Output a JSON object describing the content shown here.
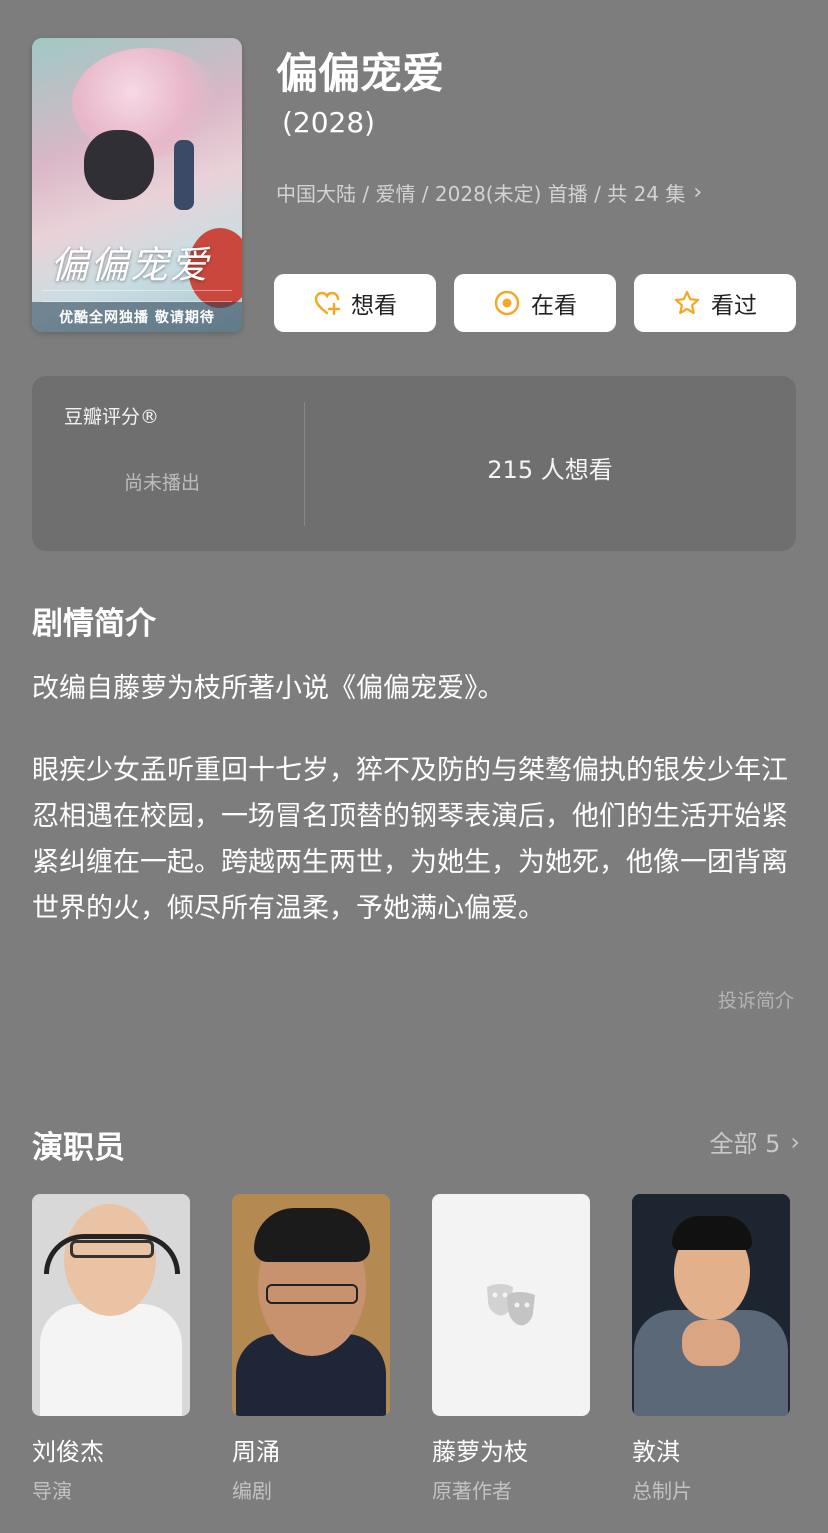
{
  "poster": {
    "title_art": "偏偏宠爱",
    "banner": "优酷全网独播 敬请期待"
  },
  "header": {
    "title": "偏偏宠爱",
    "year": "(2028)",
    "meta": "中国大陆 / 爱情 / 2028(未定) 首播 / 共 24 集"
  },
  "actions": [
    {
      "label": "想看",
      "icon": "heart-plus-icon",
      "color": "#f5a623"
    },
    {
      "label": "在看",
      "icon": "target-circle-icon",
      "color": "#f5a623"
    },
    {
      "label": "看过",
      "icon": "star-icon",
      "color": "#f5a623"
    }
  ],
  "rating": {
    "label": "豆瓣评分®",
    "status": "尚未播出",
    "wish_count": "215 人想看"
  },
  "synopsis": {
    "title": "剧情简介",
    "para1": "改编自藤萝为枝所著小说《偏偏宠爱》。",
    "para2": "眼疾少女孟听重回十七岁，猝不及防的与桀骜偏执的银发少年江忍相遇在校园，一场冒名顶替的钢琴表演后，他们的生活开始紧紧纠缠在一起。跨越两生两世，为她生，为她死，他像一团背离世界的火，倾尽所有温柔，予她满心偏爱。",
    "report": "投诉简介"
  },
  "cast": {
    "title": "演职员",
    "all_label": "全部 5",
    "members": [
      {
        "name": "刘俊杰",
        "role": "导演"
      },
      {
        "name": "周涌",
        "role": "编剧"
      },
      {
        "name": "藤萝为枝",
        "role": "原著作者"
      },
      {
        "name": "敦淇",
        "role": "总制片"
      }
    ]
  },
  "colors": {
    "background": "#7d7d7d",
    "card": "#6f6f6f",
    "accent": "#f5a623"
  }
}
